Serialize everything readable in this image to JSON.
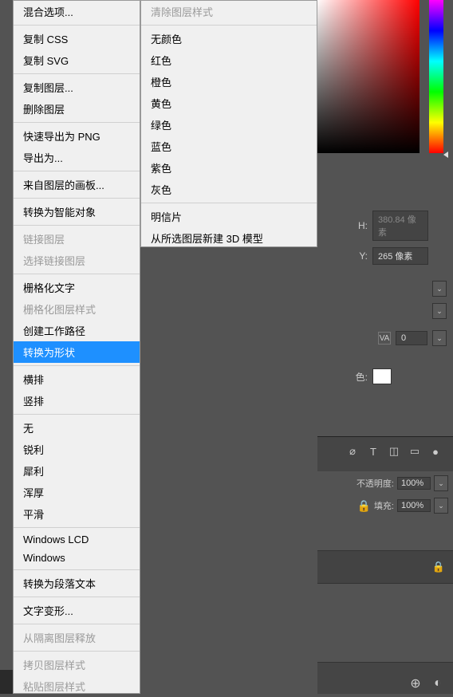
{
  "left_menu": {
    "groups": [
      {
        "items": [
          {
            "label": "混合选项...",
            "disabled": false
          }
        ]
      },
      {
        "items": [
          {
            "label": "复制 CSS",
            "disabled": false
          },
          {
            "label": "复制 SVG",
            "disabled": false
          }
        ]
      },
      {
        "items": [
          {
            "label": "复制图层...",
            "disabled": false
          },
          {
            "label": "删除图层",
            "disabled": false
          }
        ]
      },
      {
        "items": [
          {
            "label": "快速导出为 PNG",
            "disabled": false
          },
          {
            "label": "导出为...",
            "disabled": false
          }
        ]
      },
      {
        "items": [
          {
            "label": "来自图层的画板...",
            "disabled": false
          }
        ]
      },
      {
        "items": [
          {
            "label": "转换为智能对象",
            "disabled": false
          }
        ]
      },
      {
        "items": [
          {
            "label": "链接图层",
            "disabled": true
          },
          {
            "label": "选择链接图层",
            "disabled": true
          }
        ]
      },
      {
        "items": [
          {
            "label": "栅格化文字",
            "disabled": false
          },
          {
            "label": "栅格化图层样式",
            "disabled": true
          },
          {
            "label": "创建工作路径",
            "disabled": false
          },
          {
            "label": "转换为形状",
            "disabled": false,
            "highlighted": true
          }
        ]
      },
      {
        "items": [
          {
            "label": "横排",
            "disabled": false
          },
          {
            "label": "竖排",
            "disabled": false
          }
        ]
      },
      {
        "items": [
          {
            "label": "无",
            "disabled": false
          },
          {
            "label": "锐利",
            "disabled": false
          },
          {
            "label": "犀利",
            "disabled": false
          },
          {
            "label": "浑厚",
            "disabled": false
          },
          {
            "label": "平滑",
            "disabled": false
          }
        ]
      },
      {
        "items": [
          {
            "label": "Windows LCD",
            "disabled": false
          },
          {
            "label": "Windows",
            "disabled": false
          }
        ]
      },
      {
        "items": [
          {
            "label": "转换为段落文本",
            "disabled": false
          }
        ]
      },
      {
        "items": [
          {
            "label": "文字变形...",
            "disabled": false
          }
        ]
      },
      {
        "items": [
          {
            "label": "从隔离图层释放",
            "disabled": true
          }
        ]
      },
      {
        "items": [
          {
            "label": "拷贝图层样式",
            "disabled": true
          },
          {
            "label": "粘贴图层样式",
            "disabled": true
          }
        ]
      }
    ]
  },
  "right_menu": {
    "groups": [
      {
        "items": [
          {
            "label": "清除图层样式",
            "disabled": true
          }
        ]
      },
      {
        "items": [
          {
            "label": "无颜色"
          },
          {
            "label": "红色"
          },
          {
            "label": "橙色"
          },
          {
            "label": "黄色"
          },
          {
            "label": "绿色"
          },
          {
            "label": "蓝色"
          },
          {
            "label": "紫色"
          },
          {
            "label": "灰色"
          }
        ]
      },
      {
        "items": [
          {
            "label": "明信片"
          },
          {
            "label": "从所选图层新建 3D 模型"
          }
        ]
      }
    ]
  },
  "props": {
    "h_label": "H:",
    "h_value": "380.84 像素",
    "y_label": "Y:",
    "y_value": "265 像素",
    "va_value": "0",
    "color_label": "色:",
    "color_swatch": "#ffffff"
  },
  "layers": {
    "opacity_label": "不透明度:",
    "opacity_value": "100%",
    "fill_label": "填充:",
    "fill_value": "100%"
  }
}
